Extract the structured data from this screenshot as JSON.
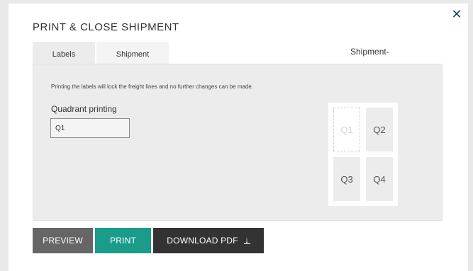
{
  "dialog": {
    "title": "PRINT & CLOSE SHIPMENT",
    "close_icon": "close-icon",
    "tabs": [
      {
        "label": "Labels",
        "active": true
      },
      {
        "label": "Shipment",
        "active": false
      }
    ],
    "shipment_header": "Shipment-"
  },
  "labels_panel": {
    "note": "Printing the labels will lock the freight lines and no further changes can be made.",
    "quadrant_label": "Quadrant printing",
    "quadrant_value": "Q1",
    "quadrants": [
      "Q1",
      "Q2",
      "Q3",
      "Q4"
    ],
    "selected_quadrant": "Q1"
  },
  "actions": {
    "preview_label": "PREVIEW",
    "print_label": "PRINT",
    "download_label": "DOWNLOAD PDF",
    "download_icon": "download-icon",
    "download_glyph": "⬇"
  },
  "colors": {
    "accent_print": "#1b9b8a",
    "preview_bg": "#666666",
    "download_bg": "#333333",
    "close_icon": "#1f4f56"
  }
}
